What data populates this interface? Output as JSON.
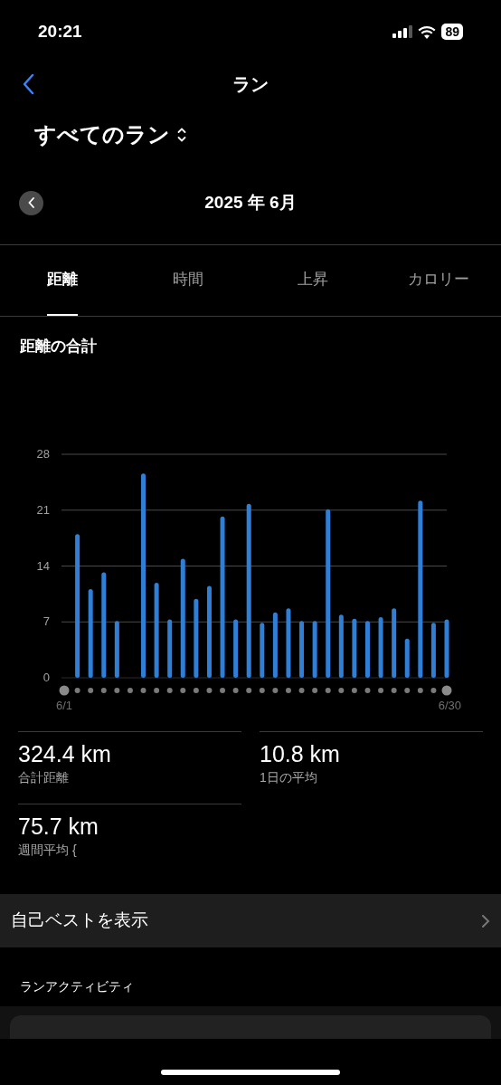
{
  "status_bar": {
    "time": "20:21",
    "battery": "89"
  },
  "nav": {
    "title": "ラン"
  },
  "filter": {
    "label": "すべてのラン"
  },
  "period": {
    "label": "2025 年 6月"
  },
  "tabs": [
    {
      "label": "距離",
      "selected": true
    },
    {
      "label": "時間",
      "selected": false
    },
    {
      "label": "上昇",
      "selected": false
    },
    {
      "label": "カロリー",
      "selected": false
    }
  ],
  "chart_section": {
    "title": "距離の合計",
    "chart_data": {
      "type": "bar",
      "categories": [
        "6/1",
        null,
        null,
        null,
        null,
        null,
        null,
        null,
        null,
        null,
        null,
        null,
        null,
        null,
        null,
        null,
        null,
        null,
        null,
        null,
        null,
        null,
        null,
        null,
        null,
        null,
        null,
        null,
        null,
        "6/30"
      ],
      "series": [
        {
          "color": "#2f7fd6",
          "values": [
            null,
            18.0,
            11.1,
            13.2,
            7.1,
            null,
            25.6,
            11.9,
            7.3,
            14.9,
            9.9,
            11.5,
            20.2,
            7.3,
            21.8,
            6.9,
            8.2,
            8.7,
            7.1,
            7.1,
            21.1,
            7.9,
            7.4,
            7.1,
            7.6,
            8.7,
            4.9,
            22.2,
            6.9,
            7.3
          ]
        }
      ],
      "ylim": [
        0,
        28
      ],
      "yticks": [
        0,
        7,
        14,
        21,
        28
      ],
      "grid": true
    }
  },
  "stats": [
    {
      "value": "324.4 km",
      "label": "合計距離"
    },
    {
      "value": "10.8 km",
      "label": "1日の平均"
    },
    {
      "value": "75.7 km",
      "label": "週間平均 {"
    }
  ],
  "best_link": {
    "label": "自己ベストを表示"
  },
  "activities": {
    "title": "ランアクティビティ"
  }
}
